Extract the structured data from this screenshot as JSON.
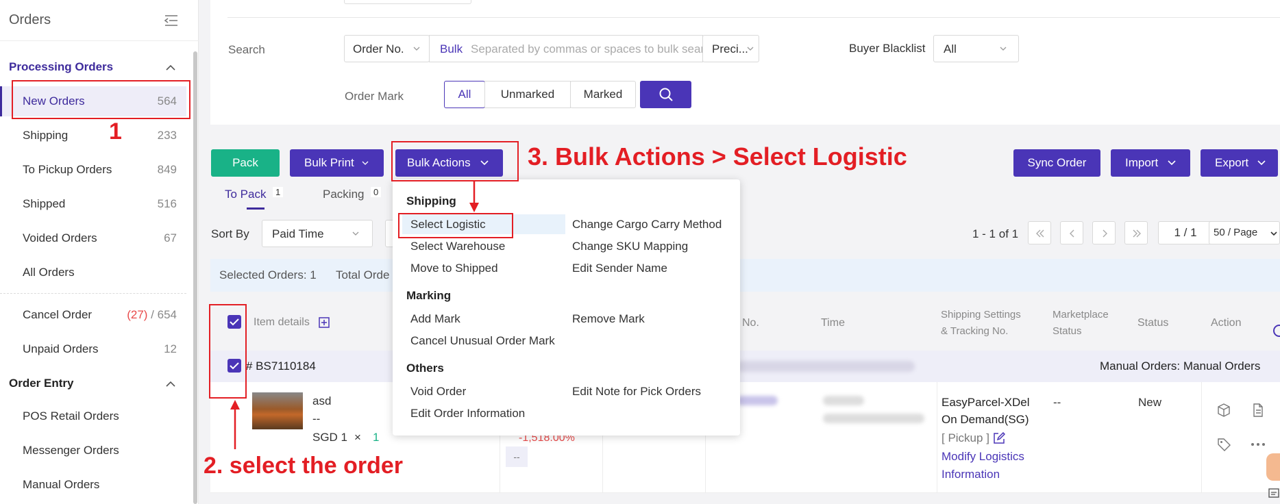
{
  "sidebar": {
    "title": "Orders",
    "groups": [
      {
        "label": "Processing Orders"
      },
      {
        "label": "Order Entry"
      }
    ],
    "items": [
      {
        "label": "New Orders",
        "count": "564"
      },
      {
        "label": "Shipping",
        "count": "233"
      },
      {
        "label": "To Pickup Orders",
        "count": "849"
      },
      {
        "label": "Shipped",
        "count": "516"
      },
      {
        "label": "Voided Orders",
        "count": "67"
      },
      {
        "label": "All Orders",
        "count": ""
      },
      {
        "label": "Cancel Order",
        "count_red": "(27)",
        "count": " / 654"
      },
      {
        "label": "Unpaid Orders",
        "count": "12"
      },
      {
        "label": "POS Retail Orders"
      },
      {
        "label": "Messenger Orders"
      },
      {
        "label": "Manual Orders"
      }
    ]
  },
  "search": {
    "label": "Search",
    "type_select": "Order No.",
    "bulk_label": "Bulk",
    "bulk_placeholder": "Separated by commas or spaces to bulk search",
    "precision_select": "Preci...",
    "blacklist_label": "Buyer Blacklist",
    "blacklist_value": "All",
    "mark_label": "Order Mark",
    "mark_options": [
      "All",
      "Unmarked",
      "Marked"
    ]
  },
  "toolbar": {
    "pack": "Pack",
    "bulk_print": "Bulk Print",
    "bulk_actions": "Bulk Actions",
    "sync": "Sync Order",
    "import": "Import",
    "export": "Export"
  },
  "tabs": [
    {
      "label": "To Pack",
      "count": "1"
    },
    {
      "label": "Packing",
      "count": "0"
    }
  ],
  "sort": {
    "label": "Sort By",
    "value": "Paid Time"
  },
  "pagination": {
    "range": "1 - 1 of 1",
    "page": "1 / 1",
    "per_page": "50 / Page"
  },
  "selection": {
    "selected": "Selected Orders: 1",
    "total": "Total Orde"
  },
  "table": {
    "headers": {
      "item": "Item details",
      "no": "No.",
      "time": "Time",
      "shipping_1": "Shipping Settings",
      "shipping_2": "& Tracking No.",
      "market_1": "Marketplace",
      "market_2": "Status",
      "status": "Status",
      "action": "Action"
    },
    "order": {
      "id": "# BS7110184",
      "source": "Manual Orders: Manual Orders",
      "item_name": "asd",
      "item_sku": "--",
      "price": "SGD 1",
      "times": "×",
      "qty": "1",
      "profit": "-1,518.00%",
      "profit_dash": "--",
      "carrier_1": "EasyParcel-XDel",
      "carrier_2": "On Demand(SG)",
      "pickup": "[ Pickup ]",
      "modify_1": "Modify Logistics",
      "modify_2": "Information",
      "market_status": "--",
      "status": "New"
    }
  },
  "bulk_menu": {
    "sections": [
      {
        "title": "Shipping",
        "items": [
          "Select Logistic",
          "Select Warehouse",
          "Move to Shipped",
          "Change Cargo Carry Method",
          "Change SKU Mapping",
          "Edit Sender Name"
        ]
      },
      {
        "title": "Marking",
        "items": [
          "Add Mark",
          "Cancel Unusual Order Mark",
          "Remove Mark"
        ]
      },
      {
        "title": "Others",
        "items": [
          "Void Order",
          "Edit Order Information",
          "Edit Note for Pick Orders"
        ]
      }
    ]
  },
  "annotations": {
    "step1": "1",
    "step2": "2. select the order",
    "step3": "3. Bulk Actions > Select Logistic"
  },
  "colors": {
    "accent": "#4a35b7",
    "green": "#19b287",
    "annotation": "#e31e24"
  }
}
